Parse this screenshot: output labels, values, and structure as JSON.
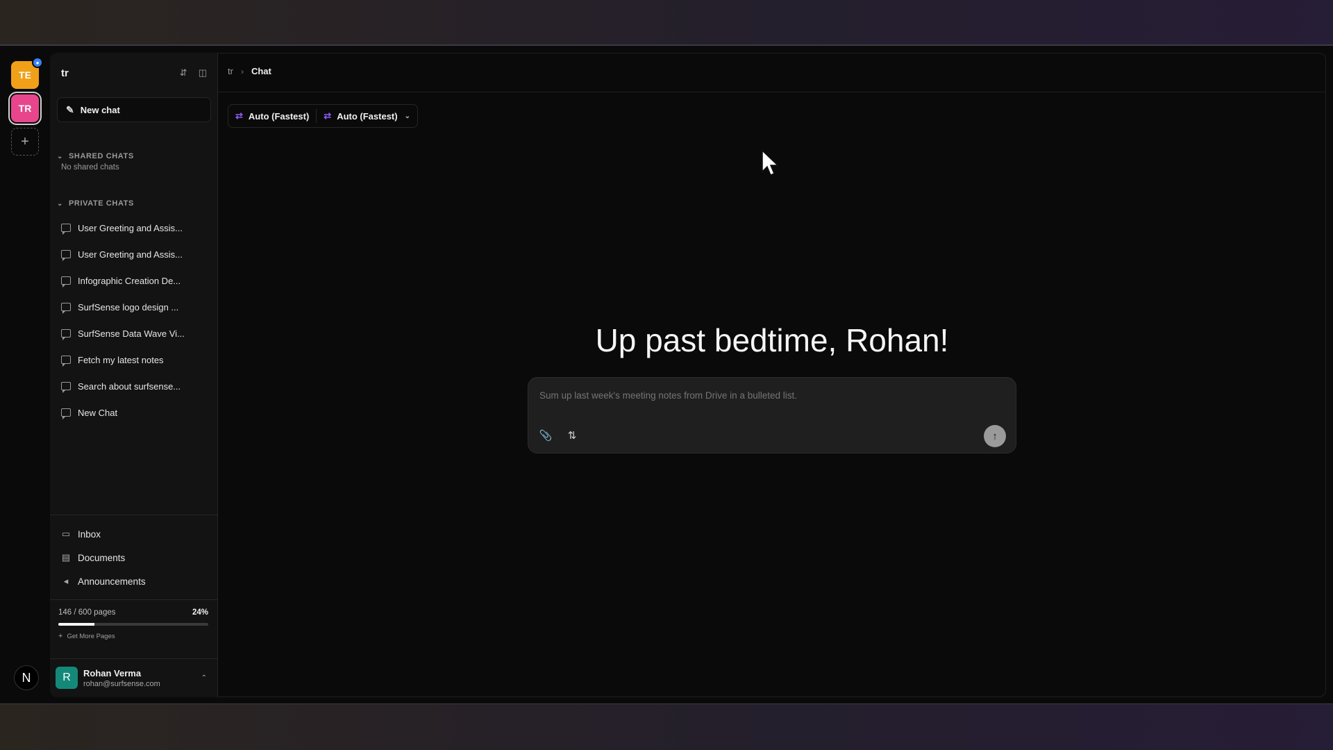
{
  "workspaces": [
    {
      "initials": "TE",
      "color": "#f0a018"
    },
    {
      "initials": "TR",
      "color": "#e8468c"
    }
  ],
  "add_workspace": "+",
  "bottom_logo": "N",
  "sidebar": {
    "title": "tr",
    "new_chat": "New chat",
    "shared_section": "SHARED CHATS",
    "shared_empty": "No shared chats",
    "private_section": "PRIVATE CHATS",
    "private_chats": [
      "User Greeting and Assis...",
      "User Greeting and Assis...",
      "Infographic Creation De...",
      "SurfSense logo design ...",
      "SurfSense Data Wave Vi...",
      "Fetch my latest notes",
      "Search about surfsense...",
      "New Chat"
    ],
    "nav": [
      {
        "label": "Inbox",
        "icon": "inbox-icon"
      },
      {
        "label": "Documents",
        "icon": "documents-icon"
      },
      {
        "label": "Announcements",
        "icon": "megaphone-icon"
      }
    ],
    "usage": {
      "pages_text": "146 / 600 pages",
      "percent_text": "24%",
      "fraction": 0.24,
      "get_more": "Get More Pages"
    },
    "user": {
      "initial": "R",
      "name": "Rohan Verma",
      "email": "rohan@surfsense.com"
    }
  },
  "main": {
    "breadcrumb": [
      "tr",
      "Chat"
    ],
    "model_selector": [
      "Auto (Fastest)",
      "Auto (Fastest)"
    ],
    "greeting": "Up past bedtime, Rohan!",
    "composer_placeholder": "Sum up last week's meeting notes from Drive in a bulleted list."
  },
  "colors": {
    "accent_purple": "#8b5cf6",
    "user_avatar": "#14897a"
  }
}
